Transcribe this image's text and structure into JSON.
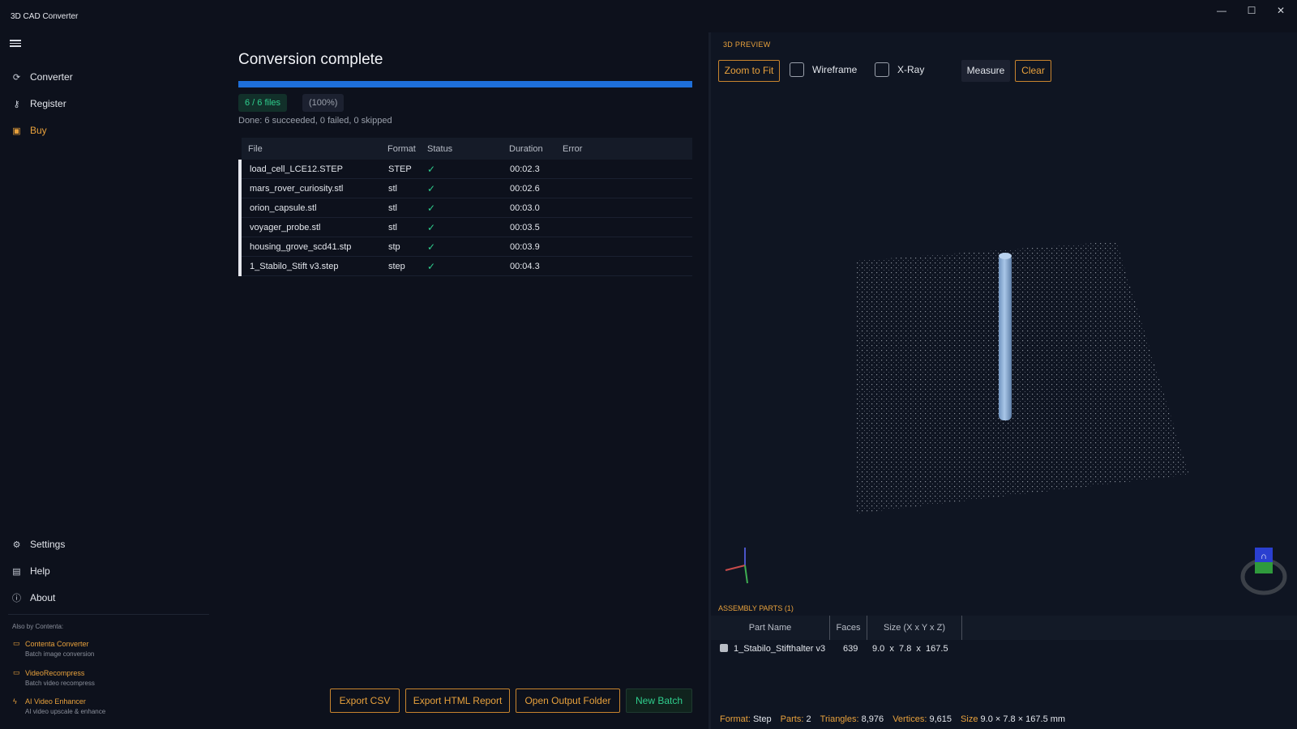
{
  "app": {
    "title": "3D CAD Converter",
    "window_controls": {
      "minimize": "—",
      "maximize": "☐",
      "close": "✕"
    }
  },
  "sidebar": {
    "menu_icon": "hamburger-icon",
    "items": [
      {
        "label": "Converter",
        "icon": "refresh-icon"
      },
      {
        "label": "Register",
        "icon": "key-icon"
      },
      {
        "label": "Buy",
        "icon": "bag-icon"
      }
    ],
    "bottom_items": [
      {
        "label": "Settings",
        "icon": "gear-icon"
      },
      {
        "label": "Help",
        "icon": "book-icon"
      },
      {
        "label": "About",
        "icon": "info-icon"
      }
    ],
    "also_by": "Also by Contenta:",
    "promos": [
      {
        "title": "Contenta Converter",
        "subtitle": "Batch image conversion",
        "icon": "image-icon"
      },
      {
        "title": "VideoRecompress",
        "subtitle": "Batch video recompress",
        "icon": "video-icon"
      },
      {
        "title": "AI Video Enhancer",
        "subtitle": "AI video upscale & enhance",
        "icon": "bolt-icon"
      }
    ]
  },
  "main": {
    "title": "Conversion complete",
    "progress": 1.0,
    "files_badge": "6 / 6 files",
    "percent_badge": "(100%)",
    "summary": "Done: 6 succeeded, 0 failed, 0 skipped",
    "table": {
      "headers": {
        "file": "File",
        "format": "Format",
        "status": "Status",
        "duration": "Duration",
        "error": "Error"
      },
      "rows": [
        {
          "file": "load_cell_LCE12.STEP",
          "format": "STEP",
          "status": "✓",
          "duration": "00:02.3",
          "error": ""
        },
        {
          "file": "mars_rover_curiosity.stl",
          "format": "stl",
          "status": "✓",
          "duration": "00:02.6",
          "error": ""
        },
        {
          "file": "orion_capsule.stl",
          "format": "stl",
          "status": "✓",
          "duration": "00:03.0",
          "error": ""
        },
        {
          "file": "voyager_probe.stl",
          "format": "stl",
          "status": "✓",
          "duration": "00:03.5",
          "error": ""
        },
        {
          "file": "housing_grove_scd41.stp",
          "format": "stp",
          "status": "✓",
          "duration": "00:03.9",
          "error": ""
        },
        {
          "file": "1_Stabilo_Stift v3.step",
          "format": "step",
          "status": "✓",
          "duration": "00:04.3",
          "error": ""
        }
      ]
    },
    "buttons": {
      "export_csv": "Export CSV",
      "export_html": "Export HTML Report",
      "open_folder": "Open Output Folder",
      "new_batch": "New Batch"
    }
  },
  "preview": {
    "label": "3D PREVIEW",
    "zoom_to_fit": "Zoom to Fit",
    "wireframe": "Wireframe",
    "xray": "X-Ray",
    "measure": "Measure",
    "clear": "Clear",
    "wireframe_checked": false,
    "xray_checked": false,
    "assembly_label": "ASSEMBLY PARTS",
    "assembly_count": "(1)",
    "assembly_headers": {
      "part_name": "Part Name",
      "faces": "Faces",
      "size": "Size (X x Y x Z)"
    },
    "parts": [
      {
        "name": "1_Stabilo_Stifthalter v3",
        "faces": "639",
        "size": "9.0  x  7.8  x  167.5"
      }
    ],
    "status": {
      "format_key": "Format:",
      "format_val": "Step",
      "parts_key": "Parts:",
      "parts_val": "2",
      "triangles_key": "Triangles:",
      "triangles_val": "8,976",
      "vertices_key": "Vertices:",
      "vertices_val": "9,615",
      "size_key": "Size",
      "size_val": "9.0 × 7.8 × 167.5 mm"
    },
    "colors": {
      "accent": "#e8a13c",
      "success": "#2fcf8e",
      "progress": "#1e6fd9",
      "model": "#8fb3d9"
    }
  }
}
